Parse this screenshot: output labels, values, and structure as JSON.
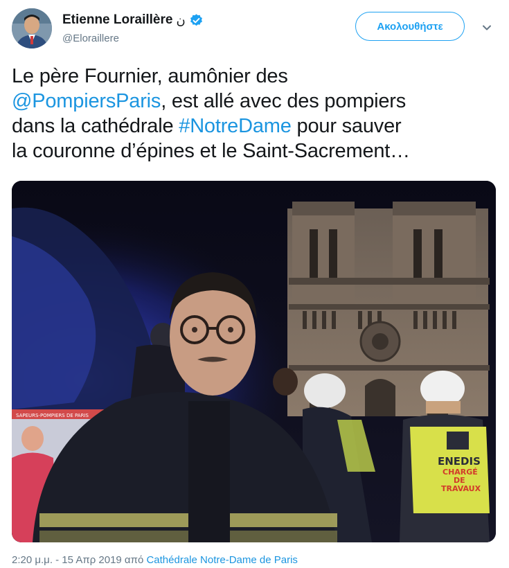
{
  "user": {
    "display_name": "Etienne Loraillère",
    "name_suffix": "ن",
    "handle": "@Eloraillere",
    "verified_icon": "verified-badge-icon",
    "verified_color": "#1da1f2"
  },
  "actions": {
    "follow_label": "Ακολουθήστε",
    "menu_icon": "chevron-down-icon"
  },
  "tweet": {
    "line1": "Le père Fournier, aumônier des",
    "mention": "@PompiersParis",
    "line2_rest": ", est allé avec des pompiers",
    "line3_start": "dans la cathédrale ",
    "hashtag": "#NotreDame",
    "line3_end": " pour sauver",
    "line4": "la couronne d’épines et le Saint-Sacrement…"
  },
  "media": {
    "vest_text_line1": "ENEDIS",
    "vest_text_line2": "CHARGÉ",
    "vest_text_line3": "DE",
    "vest_text_line4": "TRAVAUX",
    "truck_text": "SAPEURS-POMPIERS DE PARIS"
  },
  "meta": {
    "timestamp": "2:20 μ.μ. - 15 Απρ 2019",
    "from_word": " από ",
    "place": "Cathédrale Notre-Dame de Paris"
  },
  "colors": {
    "link": "#1b95e0",
    "text": "#14171a",
    "secondary": "#657786"
  }
}
